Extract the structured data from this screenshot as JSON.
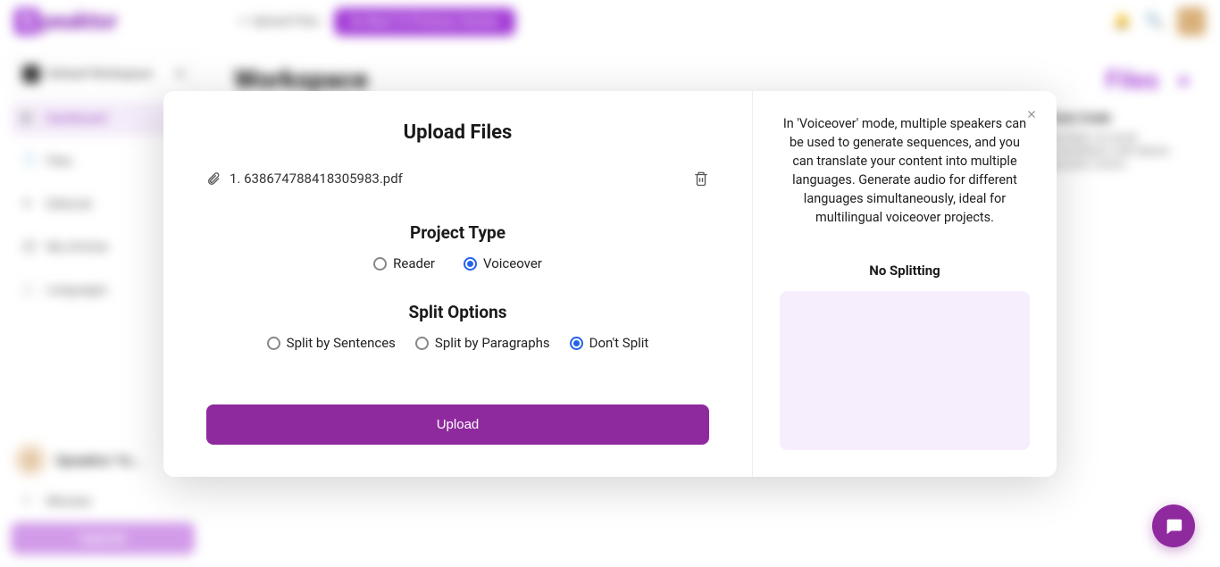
{
  "brand": {
    "name": "Speaktor",
    "badge": "S"
  },
  "topbar": {
    "upload_label": "Upload Files",
    "cta_label": "Go Back To Previous Version"
  },
  "sidebar": {
    "workspace_label": "Default Workspace",
    "items": [
      {
        "label": "Dashboard"
      },
      {
        "label": "Files"
      },
      {
        "label": "Editorial"
      },
      {
        "label": "My Articles"
      },
      {
        "label": "Languages"
      }
    ],
    "user_initial": "S",
    "user_name": "Speaktor Yo...",
    "minutes_label": "Minutes",
    "upgrade_label": "Upgrade"
  },
  "content": {
    "heading": "Workspace",
    "files_link": "Files",
    "card_title": "Created From Code",
    "card_body": "Lorem ipsum dolor sit amet consectetur incididunt velit labore dolore aliqua enim minim."
  },
  "modal": {
    "title": "Upload Files",
    "file_name": "1. 638674788418305983.pdf",
    "project_type_label": "Project Type",
    "project_types": {
      "reader": "Reader",
      "voiceover": "Voiceover",
      "selected": "voiceover"
    },
    "split_label": "Split Options",
    "split_options": {
      "sentences": "Split by Sentences",
      "paragraphs": "Split by Paragraphs",
      "none": "Don't Split",
      "selected": "none"
    },
    "upload_button": "Upload",
    "description": "In 'Voiceover' mode, multiple speakers can be used to generate sequences, and you can translate your content into multiple languages. Generate audio for different languages simultaneously, ideal for multilingual voiceover projects.",
    "no_split_title": "No Splitting"
  }
}
